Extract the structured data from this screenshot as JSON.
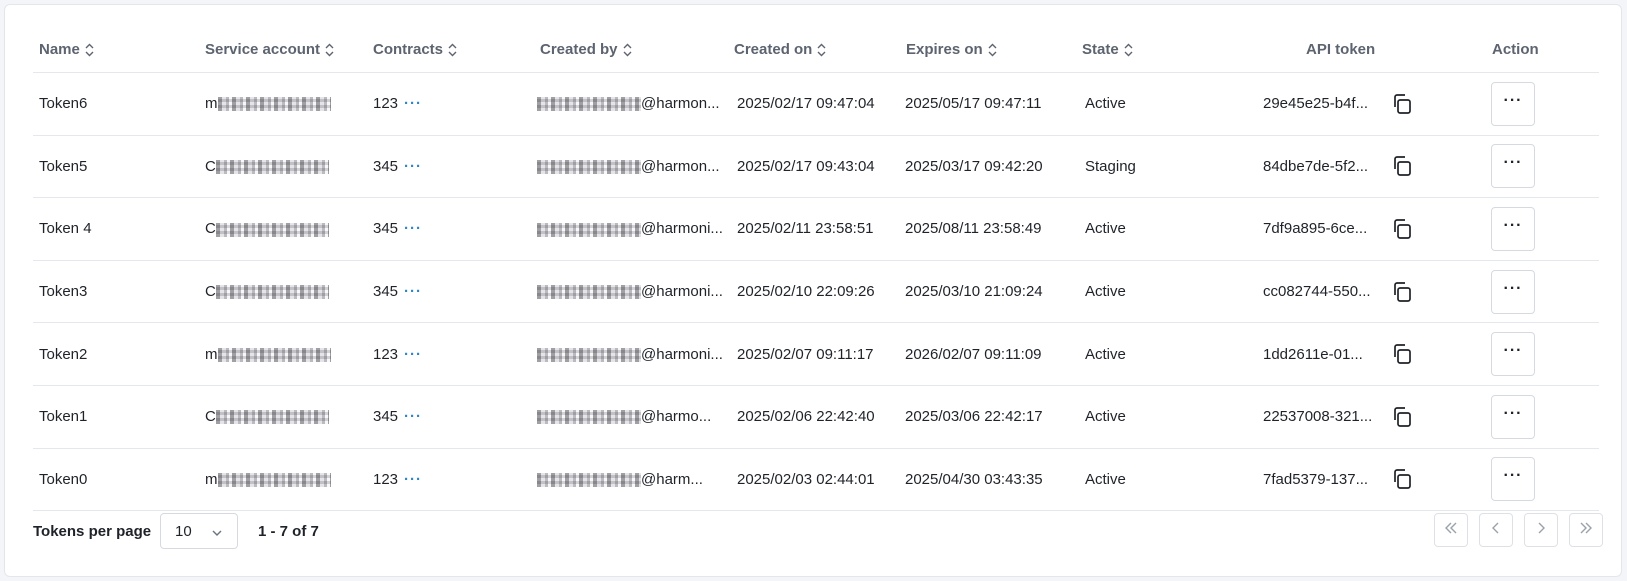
{
  "table": {
    "headers": {
      "name": "Name",
      "service_account": "Service account",
      "contracts": "Contracts",
      "created_by": "Created by",
      "created_on": "Created on",
      "expires_on": "Expires on",
      "state": "State",
      "api_token": "API token",
      "action": "Action"
    },
    "rows": [
      {
        "name": "Token6",
        "svc_prefix": "m",
        "contracts": "123",
        "created_by_domain": "@harmon...",
        "created_on": "2025/02/17 09:47:04",
        "expires_on": "2025/05/17 09:47:11",
        "state": "Active",
        "api_token": "29e45e25-b4f..."
      },
      {
        "name": "Token5",
        "svc_prefix": "C",
        "contracts": "345",
        "created_by_domain": "@harmon...",
        "created_on": "2025/02/17 09:43:04",
        "expires_on": "2025/03/17 09:42:20",
        "state": "Staging",
        "api_token": "84dbe7de-5f2..."
      },
      {
        "name": "Token 4",
        "svc_prefix": "C",
        "contracts": "345",
        "created_by_domain": "@harmoni...",
        "created_on": "2025/02/11 23:58:51",
        "expires_on": "2025/08/11 23:58:49",
        "state": "Active",
        "api_token": "7df9a895-6ce..."
      },
      {
        "name": "Token3",
        "svc_prefix": "C",
        "contracts": "345",
        "created_by_domain": "@harmoni...",
        "created_on": "2025/02/10 22:09:26",
        "expires_on": "2025/03/10 21:09:24",
        "state": "Active",
        "api_token": "cc082744-550..."
      },
      {
        "name": "Token2",
        "svc_prefix": "m",
        "contracts": "123",
        "created_by_domain": "@harmoni...",
        "created_on": "2025/02/07 09:11:17",
        "expires_on": "2026/02/07 09:11:09",
        "state": "Active",
        "api_token": "1dd2611e-01..."
      },
      {
        "name": "Token1",
        "svc_prefix": "C",
        "contracts": "345",
        "created_by_domain": "@harmo...",
        "created_on": "2025/02/06 22:42:40",
        "expires_on": "2025/03/06 22:42:17",
        "state": "Active",
        "api_token": "22537008-321..."
      },
      {
        "name": "Token0",
        "svc_prefix": "m",
        "contracts": "123",
        "created_by_domain": "@harm...",
        "created_on": "2025/02/03 02:44:01",
        "expires_on": "2025/04/30 03:43:35",
        "state": "Active",
        "api_token": "7fad5379-137..."
      }
    ],
    "contracts_more_glyph": "···",
    "action_glyph": "···"
  },
  "footer": {
    "per_page_label": "Tokens per page",
    "per_page_value": "10",
    "range_text": "1 - 7 of 7"
  },
  "icons": {
    "sort": "sort-icon",
    "copy": "copy-icon",
    "more": "more-horizontal-icon",
    "chevron_down": "chevron-down-icon",
    "first": "chevrons-left-icon",
    "prev": "chevron-left-icon",
    "next": "chevron-right-icon",
    "last": "chevrons-right-icon"
  },
  "colors": {
    "accent": "#2a86c9",
    "header_text": "#5d6470",
    "border": "#e4e7eb"
  }
}
